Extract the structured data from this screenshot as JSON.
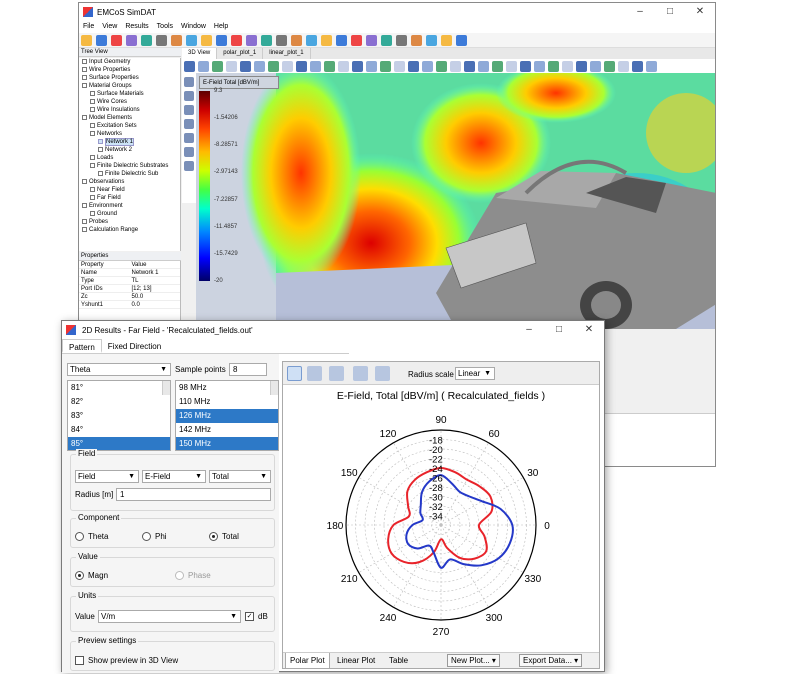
{
  "app": {
    "title": "EMCoS SimDAT",
    "menu": [
      "File",
      "View",
      "Results",
      "Tools",
      "Window",
      "Help"
    ],
    "tabs": [
      "3D View",
      "polar_plot_1",
      "linear_plot_1"
    ],
    "tree_header": "Tree View",
    "tree_items": [
      {
        "label": "Input Geometry",
        "indent": 0
      },
      {
        "label": "Wire Properties",
        "indent": 0
      },
      {
        "label": "Surface Properties",
        "indent": 0
      },
      {
        "label": "Material Groups",
        "indent": 0
      },
      {
        "label": "Surface Materials",
        "indent": 1
      },
      {
        "label": "Wire Cores",
        "indent": 1
      },
      {
        "label": "Wire Insulations",
        "indent": 1
      },
      {
        "label": "Model Elements",
        "indent": 0
      },
      {
        "label": "Excitation Sets",
        "indent": 1
      },
      {
        "label": "Networks",
        "indent": 1
      },
      {
        "label": "Network 1",
        "indent": 2,
        "selected": true
      },
      {
        "label": "Network 2",
        "indent": 2
      },
      {
        "label": "Loads",
        "indent": 1
      },
      {
        "label": "Finite Dielectric Substrates",
        "indent": 1
      },
      {
        "label": "Finite Dielectric Sub",
        "indent": 2
      },
      {
        "label": "Observations",
        "indent": 0
      },
      {
        "label": "Near Field",
        "indent": 1
      },
      {
        "label": "Far Field",
        "indent": 1
      },
      {
        "label": "Environment",
        "indent": 0
      },
      {
        "label": "Ground",
        "indent": 1
      },
      {
        "label": "Probes",
        "indent": 0
      },
      {
        "label": "Calculation Range",
        "indent": 0
      }
    ],
    "props_header": "Properties",
    "props": [
      [
        "Property",
        "Value"
      ],
      [
        "Name",
        "Network 1"
      ],
      [
        "Type",
        "TL"
      ],
      [
        "Port IDs",
        "[12; 13]"
      ],
      [
        "Zc",
        "50.0"
      ],
      [
        "Yshunt1",
        "0.0"
      ]
    ],
    "legend_title": "E-Field Total [dBV/m]",
    "colorbar_labels": [
      "9.3",
      "-1.54206",
      "-8.28571",
      "-2.97143",
      "-7.22857",
      "-11.4857",
      "-15.7429",
      "-20"
    ]
  },
  "dialog": {
    "title": "2D Results - Far Field - 'Recalculated_fields.out'",
    "tabs": [
      "Pattern",
      "Fixed Direction"
    ],
    "angle_combo": "Theta",
    "sample_points_label": "Sample points",
    "sample_points_value": "8",
    "angles": [
      "81°",
      "82°",
      "83°",
      "84°",
      "85°"
    ],
    "angles_selected": 4,
    "freqs": [
      "98 MHz",
      "110 MHz",
      "126 MHz",
      "142 MHz",
      "150 MHz"
    ],
    "freqs_selected": [
      2,
      4
    ],
    "field_group": "Field",
    "field_combo1": "Field",
    "field_combo2": "E-Field",
    "field_combo3": "Total",
    "radius_label": "Radius [m]",
    "radius_value": "1",
    "component_group": "Component",
    "component_options": [
      "Theta",
      "Phi",
      "Total"
    ],
    "component_selected": "Total",
    "value_group": "Value",
    "value_options": [
      "Magn",
      "Phase"
    ],
    "units_group": "Units",
    "units_label": "Value",
    "units_value": "V/m",
    "db_label": "dB",
    "preview_group": "Preview settings",
    "preview_label": "Show preview in 3D View",
    "radius_scale_label": "Radius scale",
    "radius_scale_value": "Linear",
    "bottom_tabs": [
      "Polar Plot",
      "Linear Plot",
      "Table"
    ],
    "new_plot": "New Plot...",
    "export": "Export Data..."
  },
  "chart_data": {
    "type": "polar",
    "title": "E-Field, Total  [dBV/m]  ( Recalculated_fields )",
    "angle_ticks": [
      "0",
      "30",
      "60",
      "90",
      "120",
      "150",
      "180",
      "210",
      "240",
      "270",
      "300",
      "330"
    ],
    "radial_ticks": [
      "-18",
      "-20",
      "-22",
      "-24",
      "-26",
      "-28",
      "-30",
      "-32",
      "-34"
    ],
    "rlim": [
      -36,
      -16
    ],
    "series": [
      {
        "color": "#e8232a",
        "angle_deg": [
          0,
          15,
          30,
          45,
          60,
          75,
          90,
          105,
          120,
          135,
          150,
          165,
          180,
          195,
          210,
          225,
          240,
          255,
          270,
          285,
          300,
          315,
          330,
          345
        ],
        "values": [
          -28,
          -25,
          -24,
          -24.5,
          -25,
          -24.5,
          -24,
          -24.5,
          -25,
          -26,
          -28,
          -29,
          -26,
          -24.5,
          -24,
          -25,
          -27,
          -30,
          -33,
          -31,
          -28,
          -26,
          -25,
          -26.5
        ]
      },
      {
        "color": "#2438c8",
        "angle_deg": [
          0,
          15,
          30,
          45,
          60,
          75,
          90,
          105,
          120,
          135,
          150,
          165,
          180,
          195,
          210,
          225,
          240,
          255,
          270,
          285,
          300,
          315,
          330,
          345
        ],
        "values": [
          -21,
          -23,
          -26,
          -27.5,
          -28,
          -27,
          -25.5,
          -26.5,
          -28,
          -30,
          -31,
          -32,
          -30,
          -28.5,
          -28,
          -29,
          -31,
          -30,
          -27,
          -28.5,
          -26.5,
          -24,
          -22,
          -21
        ]
      }
    ]
  }
}
